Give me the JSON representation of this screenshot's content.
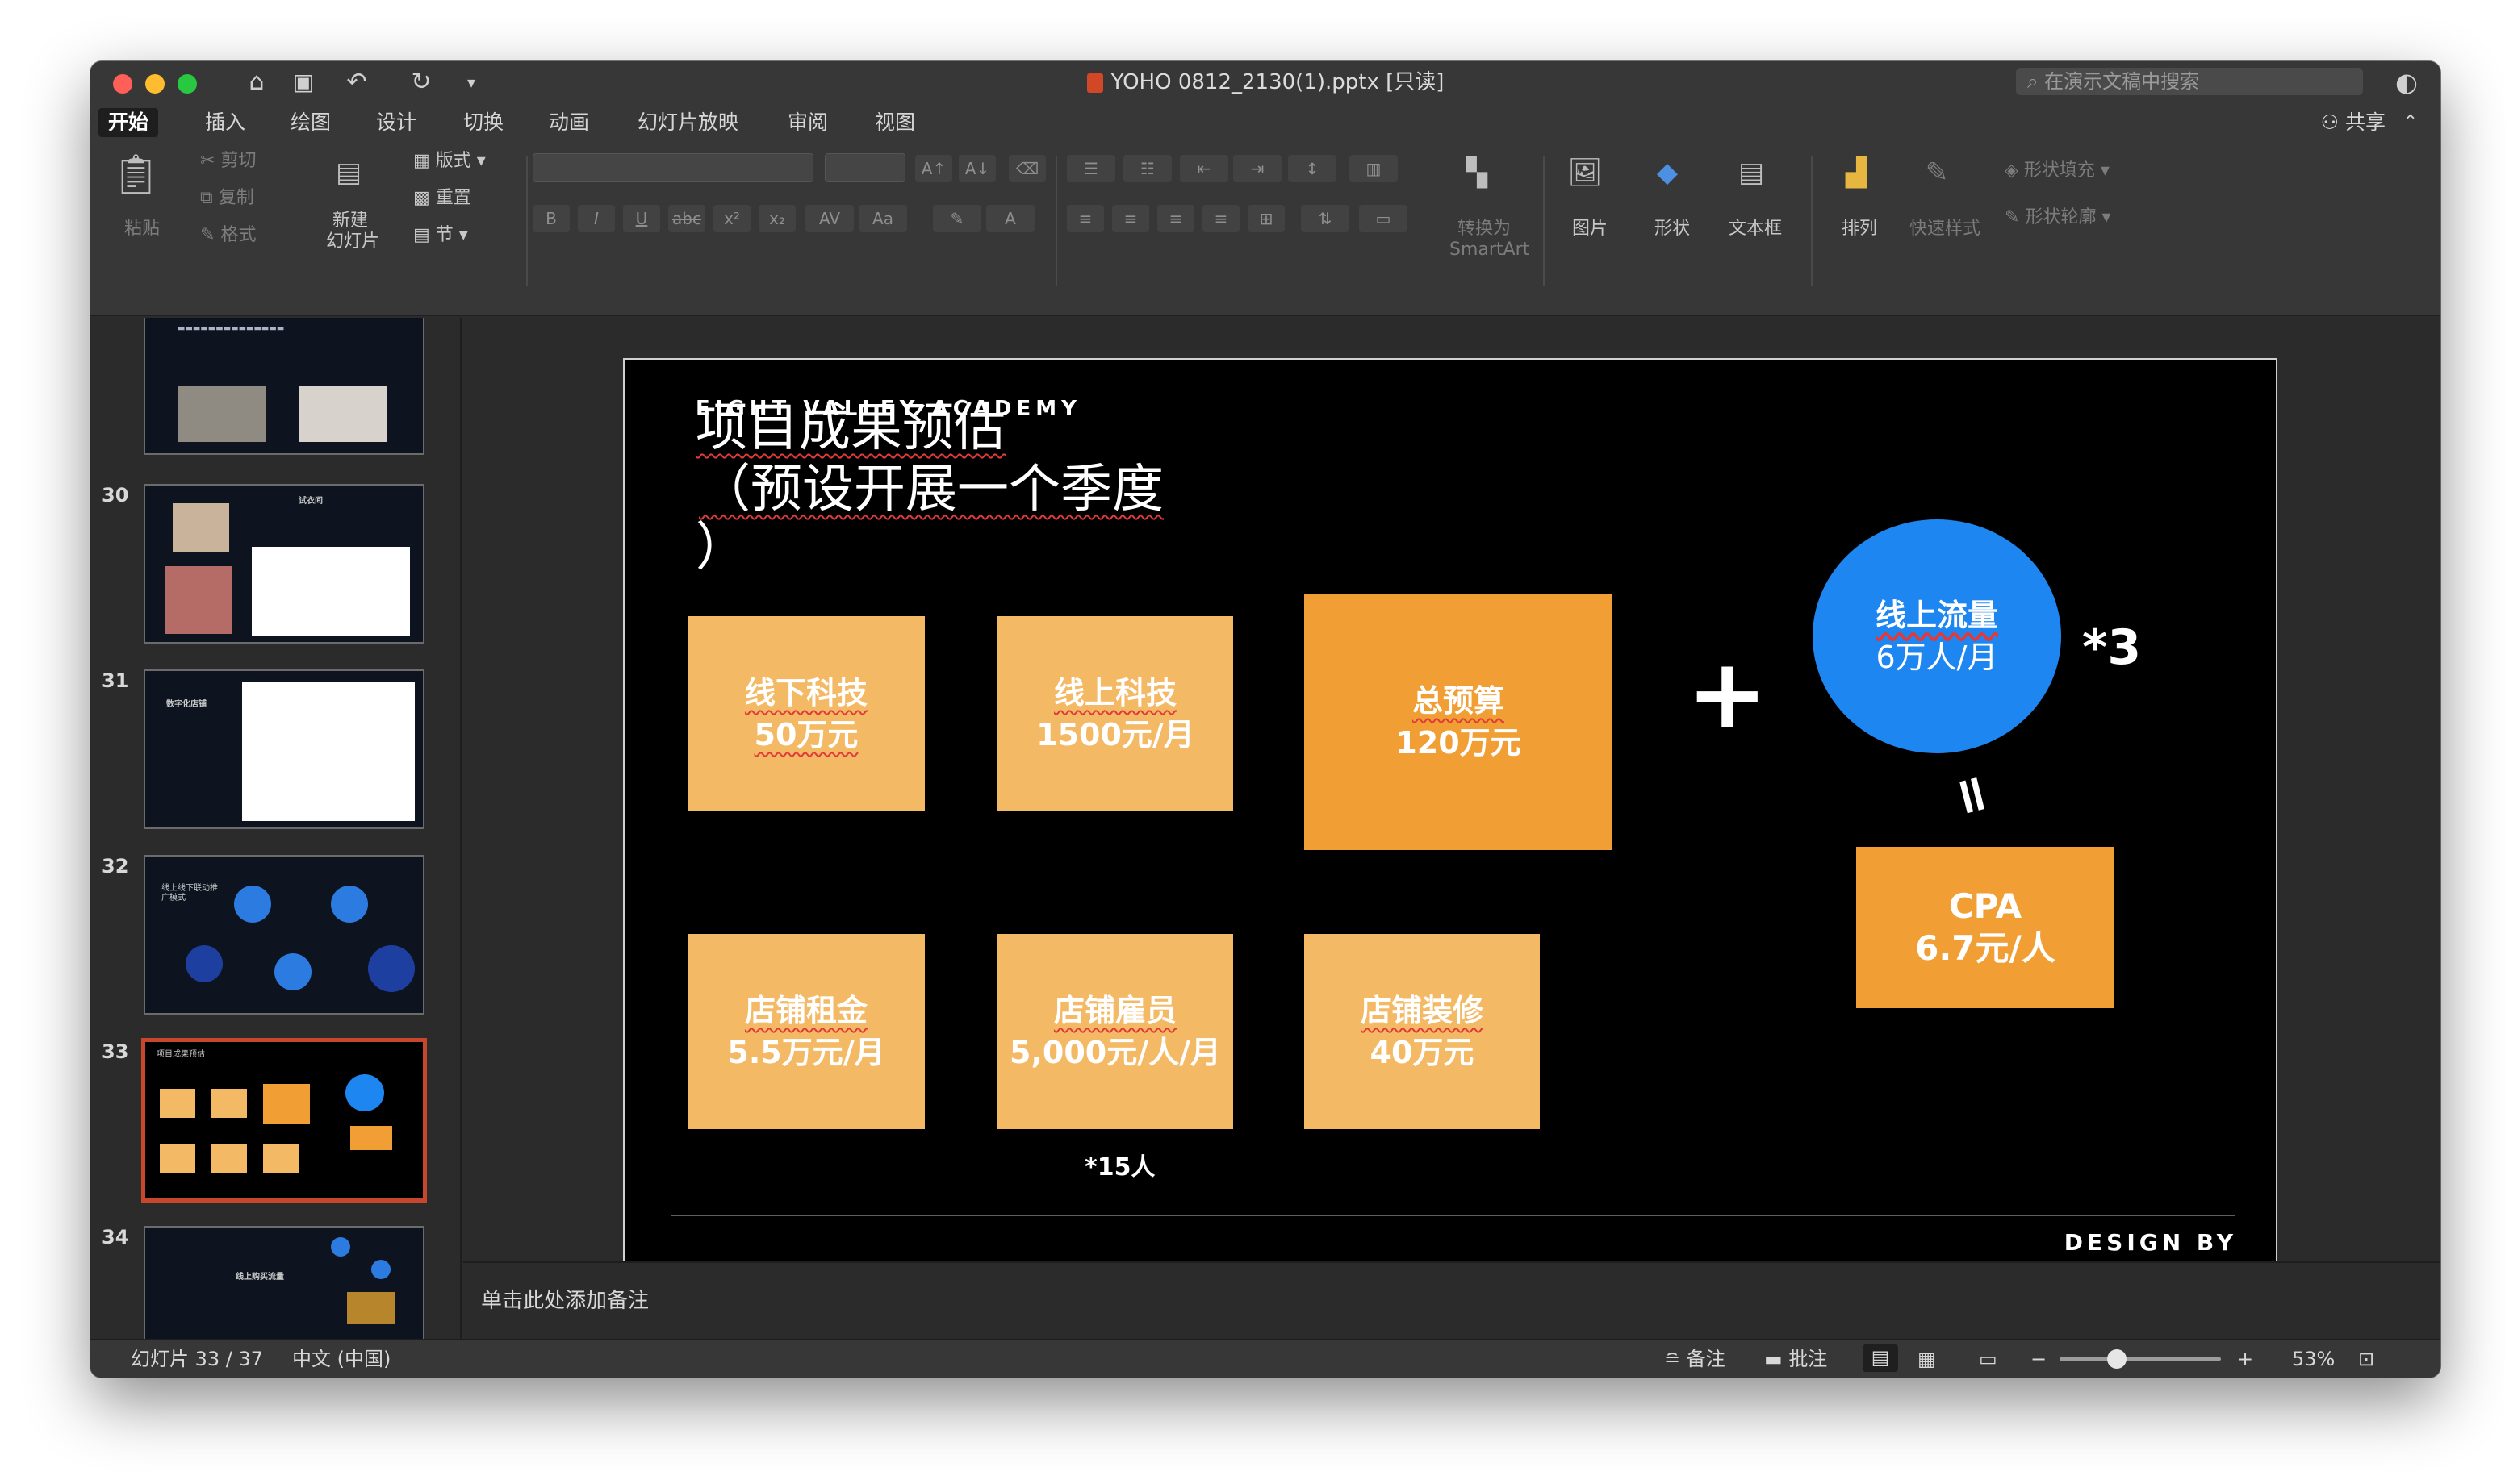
{
  "window": {
    "title": "YOHO 0812_2130(1).pptx [只读]",
    "search_placeholder": "在演示文稿中搜索"
  },
  "tabs": [
    "开始",
    "插入",
    "绘图",
    "设计",
    "切换",
    "动画",
    "幻灯片放映",
    "审阅",
    "视图"
  ],
  "share_label": "共享",
  "ribbon": {
    "paste": "粘贴",
    "cut": "剪切",
    "copy": "复制",
    "format": "格式",
    "new_slide_1": "新建",
    "new_slide_2": "幻灯片",
    "layout": "版式",
    "reset": "重置",
    "section": "节",
    "smartart_1": "转换为",
    "smartart_2": "SmartArt",
    "picture": "图片",
    "shape": "形状",
    "textbox": "文本框",
    "arrange": "排列",
    "quick_styles": "快速样式",
    "shape_fill": "形状填充",
    "shape_outline": "形状轮廓"
  },
  "thumbnails": [
    {
      "number": "",
      "label": ""
    },
    {
      "number": "30",
      "label": "试衣间"
    },
    {
      "number": "31",
      "label": "数字化店铺"
    },
    {
      "number": "32",
      "label": "线上线下联动推广模式"
    },
    {
      "number": "33",
      "label": "项目成果预估"
    },
    {
      "number": "34",
      "label": "线上购买流量"
    }
  ],
  "slide": {
    "brand": "EIGHT VALLEY ACADEMY",
    "title_line1": "项目成果预估",
    "title_line2": "（预设开展一个季度",
    "title_line3": "）",
    "boxes": [
      {
        "line1": "线下科技",
        "line2": "50万元"
      },
      {
        "line1": "线上科技",
        "line2": "1500元/月"
      },
      {
        "line1": "总预算",
        "line2": "120万元"
      },
      {
        "line1": "店铺租金",
        "line2": "5.5万元/月"
      },
      {
        "line1": "店铺雇员",
        "line2": "5,000元/人/月"
      },
      {
        "line1": "店铺装修",
        "line2": "40万元"
      },
      {
        "line1": "CPA",
        "line2": "6.7元/人"
      }
    ],
    "circle": {
      "line1": "线上流量",
      "line2": "6万人/月"
    },
    "plus": "+",
    "multiplier": "*3",
    "equals": "=",
    "staff_note": "*15人",
    "footer": "DESIGN BY"
  },
  "notes_placeholder": "单击此处添加备注",
  "status": {
    "slide_counter": "幻灯片 33 / 37",
    "language": "中文 (中国)",
    "notes": "备注",
    "comments": "批注",
    "zoom_minus": "−",
    "zoom_plus": "+",
    "zoom_percent": "53%",
    "zoom_level": 0.53
  },
  "colors": {
    "box_light": "#f4b965",
    "box_dark": "#f19f34",
    "circle_blue": "#1e86f0",
    "selection": "#c8462c"
  }
}
